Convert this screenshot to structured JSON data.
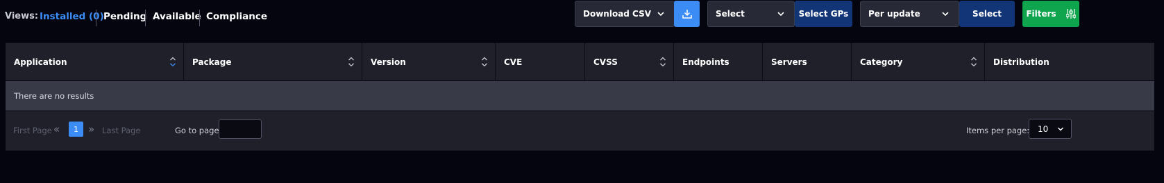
{
  "views": {
    "label": "Views:",
    "items": [
      {
        "label": "Installed (0)",
        "active": true
      },
      {
        "label": "Pending",
        "active": false
      },
      {
        "label": "Available",
        "active": false
      },
      {
        "label": "Compliance",
        "active": false
      }
    ]
  },
  "toolbar": {
    "download_label": "Download CSV",
    "download_icon": "download-icon",
    "gp_select_value": "Select",
    "gp_button_label": "Select GPs",
    "update_select_value": "Per update",
    "update_button_label": "Select",
    "filters_label": "Filters",
    "filters_icon": "sliders-icon"
  },
  "table": {
    "columns": [
      {
        "label": "Application",
        "sortable": true
      },
      {
        "label": "Package",
        "sortable": true
      },
      {
        "label": "Version",
        "sortable": true
      },
      {
        "label": "CVE",
        "sortable": false
      },
      {
        "label": "CVSS",
        "sortable": true
      },
      {
        "label": "Endpoints",
        "sortable": false
      },
      {
        "label": "Servers",
        "sortable": false
      },
      {
        "label": "Category",
        "sortable": true
      },
      {
        "label": "Distribution",
        "sortable": false
      }
    ],
    "empty_message": "There are no results"
  },
  "pagination": {
    "first_label": "First Page",
    "last_label": "Last Page",
    "current_page": "1",
    "goto_label": "Go to page:",
    "goto_value": "",
    "items_per_page_label": "Items per page:",
    "items_per_page_value": "10"
  },
  "colors": {
    "background": "#05050f",
    "accent_blue": "#3b8cf5",
    "dark_blue": "#123578",
    "green": "#0fa44e",
    "panel": "#1f2029",
    "empty_row": "#393a48"
  }
}
